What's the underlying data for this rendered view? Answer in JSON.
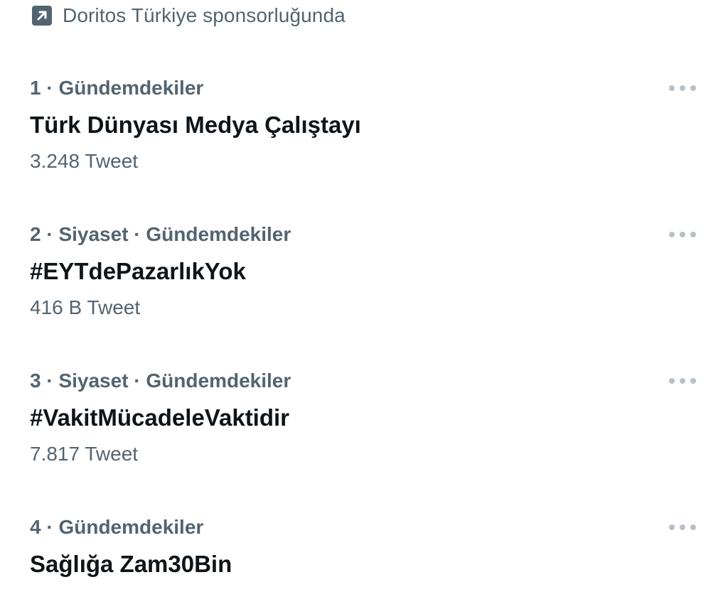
{
  "promoted": {
    "icon": "promoted-arrow-icon",
    "text": "Doritos Türkiye sponsorluğunda"
  },
  "trends": [
    {
      "meta": "1 · Gündemdekiler",
      "title": "Türk Dünyası Medya Çalıştayı",
      "count": "3.248 Tweet"
    },
    {
      "meta": "2 · Siyaset · Gündemdekiler",
      "title": "#EYTdePazarlıkYok",
      "count": "416 B Tweet"
    },
    {
      "meta": "3 · Siyaset · Gündemdekiler",
      "title": "#VakitMücadeleVaktidir",
      "count": "7.817 Tweet"
    },
    {
      "meta": "4 · Gündemdekiler",
      "title": "Sağlığa Zam30Bin",
      "count": ""
    }
  ],
  "colors": {
    "secondary_text": "#536471",
    "primary_text": "#0f1419",
    "icon_grey": "#536471"
  }
}
